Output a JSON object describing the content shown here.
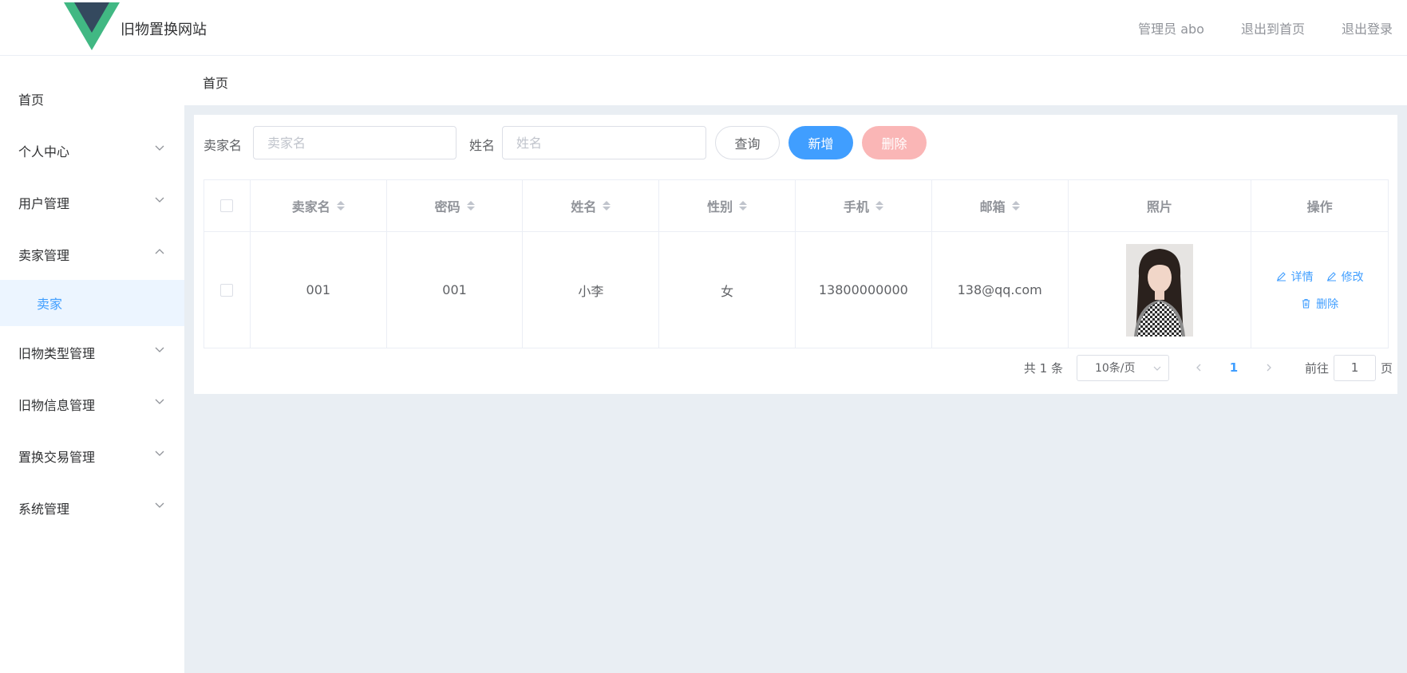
{
  "header": {
    "site_title": "旧物置换网站",
    "admin_label": "管理员 abo",
    "exit_home": "退出到首页",
    "logout": "退出登录"
  },
  "sidebar": {
    "items": [
      {
        "label": "首页",
        "expandable": false
      },
      {
        "label": "个人中心",
        "expandable": true
      },
      {
        "label": "用户管理",
        "expandable": true
      },
      {
        "label": "卖家管理",
        "expandable": true,
        "expanded": true
      },
      {
        "label": "卖家",
        "sub": true,
        "active": true
      },
      {
        "label": "旧物类型管理",
        "expandable": true
      },
      {
        "label": "旧物信息管理",
        "expandable": true
      },
      {
        "label": "置换交易管理",
        "expandable": true
      },
      {
        "label": "系统管理",
        "expandable": true
      }
    ]
  },
  "breadcrumb": "首页",
  "search": {
    "seller_label": "卖家名",
    "seller_placeholder": "卖家名",
    "name_label": "姓名",
    "name_placeholder": "姓名",
    "query_button": "查询",
    "add_button": "新增",
    "delete_button": "删除"
  },
  "table": {
    "columns": [
      "卖家名",
      "密码",
      "姓名",
      "性别",
      "手机",
      "邮箱",
      "照片",
      "操作"
    ],
    "rows": [
      {
        "seller": "001",
        "password": "001",
        "name": "小李",
        "gender": "女",
        "phone": "13800000000",
        "email": "138@qq.com"
      }
    ],
    "actions": {
      "detail": "详情",
      "edit": "修改",
      "delete": "删除"
    }
  },
  "pagination": {
    "total": "共 1 条",
    "page_size": "10条/页",
    "current_page": "1",
    "goto_label": "前往",
    "goto_value": "1",
    "page_unit": "页"
  },
  "colors": {
    "primary": "#409eff",
    "danger_disabled": "#fab6b6",
    "logo_green": "#41b883",
    "logo_dark": "#34495e"
  }
}
